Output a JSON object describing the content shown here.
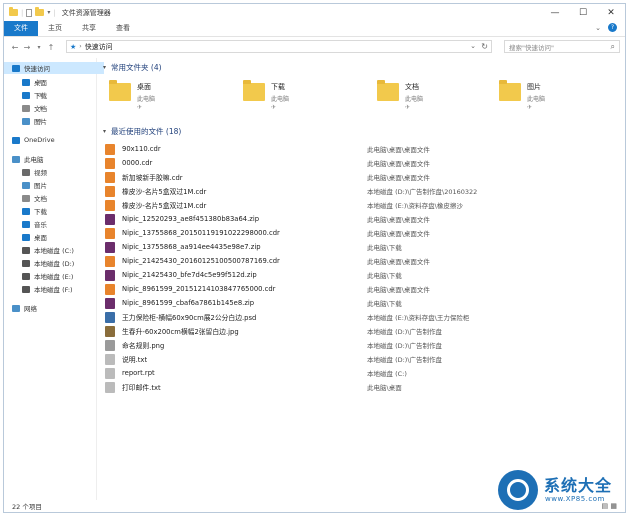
{
  "window": {
    "title": "文件资源管理器",
    "controls": [
      "—",
      "☐",
      "✕"
    ]
  },
  "ribbon": {
    "tabs": [
      {
        "label": "文件",
        "active": true
      },
      {
        "label": "主页",
        "active": false
      },
      {
        "label": "共享",
        "active": false
      },
      {
        "label": "查看",
        "active": false
      }
    ],
    "help": "?"
  },
  "address": {
    "path": "快速访问",
    "search_placeholder": "搜索\"快速访问\""
  },
  "sidebar": {
    "items": [
      {
        "label": "快速访问",
        "icon": "star-icon",
        "color": "#1979ca",
        "indent": 0,
        "selected": true,
        "pinned": false
      },
      {
        "label": "桌面",
        "icon": "desktop-icon",
        "color": "#1979ca",
        "indent": 1,
        "selected": false,
        "pinned": true
      },
      {
        "label": "下载",
        "icon": "download-icon",
        "color": "#1979ca",
        "indent": 1,
        "selected": false,
        "pinned": true
      },
      {
        "label": "文档",
        "icon": "documents-icon",
        "color": "#8a8a8a",
        "indent": 1,
        "selected": false,
        "pinned": true
      },
      {
        "label": "图片",
        "icon": "pictures-icon",
        "color": "#4a90c8",
        "indent": 1,
        "selected": false,
        "pinned": true
      },
      {
        "label": "OneDrive",
        "icon": "cloud-icon",
        "color": "#1979ca",
        "indent": 0,
        "selected": false,
        "pinned": false
      },
      {
        "label": "此电脑",
        "icon": "computer-icon",
        "color": "#4a90c8",
        "indent": 0,
        "selected": false,
        "pinned": false
      },
      {
        "label": "视频",
        "icon": "video-icon",
        "color": "#6a6a6a",
        "indent": 1,
        "selected": false,
        "pinned": false
      },
      {
        "label": "图片",
        "icon": "pictures-icon",
        "color": "#4a90c8",
        "indent": 1,
        "selected": false,
        "pinned": false
      },
      {
        "label": "文档",
        "icon": "documents-icon",
        "color": "#8a8a8a",
        "indent": 1,
        "selected": false,
        "pinned": false
      },
      {
        "label": "下载",
        "icon": "download-icon",
        "color": "#1979ca",
        "indent": 1,
        "selected": false,
        "pinned": false
      },
      {
        "label": "音乐",
        "icon": "music-icon",
        "color": "#1979ca",
        "indent": 1,
        "selected": false,
        "pinned": false
      },
      {
        "label": "桌面",
        "icon": "desktop-icon",
        "color": "#1979ca",
        "indent": 1,
        "selected": false,
        "pinned": false
      },
      {
        "label": "本地磁盘 (C:)",
        "icon": "drive-icon",
        "color": "#555555",
        "indent": 1,
        "selected": false,
        "pinned": false
      },
      {
        "label": "本地磁盘 (D:)",
        "icon": "drive-icon",
        "color": "#555555",
        "indent": 1,
        "selected": false,
        "pinned": false
      },
      {
        "label": "本地磁盘 (E:)",
        "icon": "drive-icon",
        "color": "#555555",
        "indent": 1,
        "selected": false,
        "pinned": false
      },
      {
        "label": "本地磁盘 (F:)",
        "icon": "drive-icon",
        "color": "#555555",
        "indent": 1,
        "selected": false,
        "pinned": false
      },
      {
        "label": "网络",
        "icon": "network-icon",
        "color": "#4a90c8",
        "indent": 0,
        "selected": false,
        "pinned": false
      }
    ]
  },
  "frequent": {
    "header": "常用文件夹 (4)",
    "folders": [
      {
        "name": "桌面",
        "location": "此电脑",
        "pin": "✈",
        "icon": "desktop-folder-icon"
      },
      {
        "name": "下载",
        "location": "此电脑",
        "pin": "✈",
        "icon": "download-folder-icon"
      },
      {
        "name": "文档",
        "location": "此电脑",
        "pin": "✈",
        "icon": "documents-folder-icon"
      },
      {
        "name": "图片",
        "location": "此电脑",
        "pin": "✈",
        "icon": "pictures-folder-icon"
      }
    ]
  },
  "recent": {
    "header": "最近使用的文件 (18)",
    "files": [
      {
        "name": "90x110.cdr",
        "location": "此电脑\\桌面\\桌面文件",
        "color": "#e8842c"
      },
      {
        "name": "0000.cdr",
        "location": "此电脑\\桌面\\桌面文件",
        "color": "#e8842c"
      },
      {
        "name": "新加坡新手胶嘛.cdr",
        "location": "此电脑\\桌面\\桌面文件",
        "color": "#e8842c"
      },
      {
        "name": "橡皮沙-名片5盒双过1M.cdr",
        "location": "本地磁盘 (D:)\\广告制作盘\\20160322",
        "color": "#e8842c"
      },
      {
        "name": "橡皮沙-名片5盒双过1M.cdr",
        "location": "本地磁盘 (E:)\\资料存盘\\橡皮擦沙",
        "color": "#e8842c"
      },
      {
        "name": "Nipic_12520293_ae8f451380b83a64.zip",
        "location": "此电脑\\桌面\\桌面文件",
        "color": "#6b2d6b"
      },
      {
        "name": "Nipic_13755868_20150119191022298000.cdr",
        "location": "此电脑\\桌面\\桌面文件",
        "color": "#e8842c"
      },
      {
        "name": "Nipic_13755868_aa914ee4435e98e7.zip",
        "location": "此电脑\\下载",
        "color": "#6b2d6b"
      },
      {
        "name": "Nipic_21425430_20160125100500787169.cdr",
        "location": "此电脑\\桌面\\桌面文件",
        "color": "#e8842c"
      },
      {
        "name": "Nipic_21425430_bfe7d4c5e99f512d.zip",
        "location": "此电脑\\下载",
        "color": "#6b2d6b"
      },
      {
        "name": "Nipic_8961599_20151214103847765000.cdr",
        "location": "此电脑\\桌面\\桌面文件",
        "color": "#e8842c"
      },
      {
        "name": "Nipic_8961599_cbaf6a7861b145e8.zip",
        "location": "此电脑\\下载",
        "color": "#6b2d6b"
      },
      {
        "name": "王力保险柜-横幅60x90cm展2公分白边.psd",
        "location": "本地磁盘 (E:)\\资料存盘\\王力保险柜",
        "color": "#3a6ea8"
      },
      {
        "name": "生春升-60x200cm横幅2张留白边.jpg",
        "location": "本地磁盘 (D:)\\广告制作盘",
        "color": "#8a6d3b"
      },
      {
        "name": "命名规则.png",
        "location": "本地磁盘 (D:)\\广告制作盘",
        "color": "#9a9a9a"
      },
      {
        "name": "说明.txt",
        "location": "本地磁盘 (D:)\\广告制作盘",
        "color": "#bbbbbb"
      },
      {
        "name": "report.rpt",
        "location": "本地磁盘 (C:)",
        "color": "#bbbbbb"
      },
      {
        "name": "打印邮件.txt",
        "location": "此电脑\\桌面",
        "color": "#bbbbbb"
      }
    ]
  },
  "status": {
    "count": "22 个项目"
  },
  "watermark": {
    "title": "系统大全",
    "url": "www.XP85.com"
  }
}
